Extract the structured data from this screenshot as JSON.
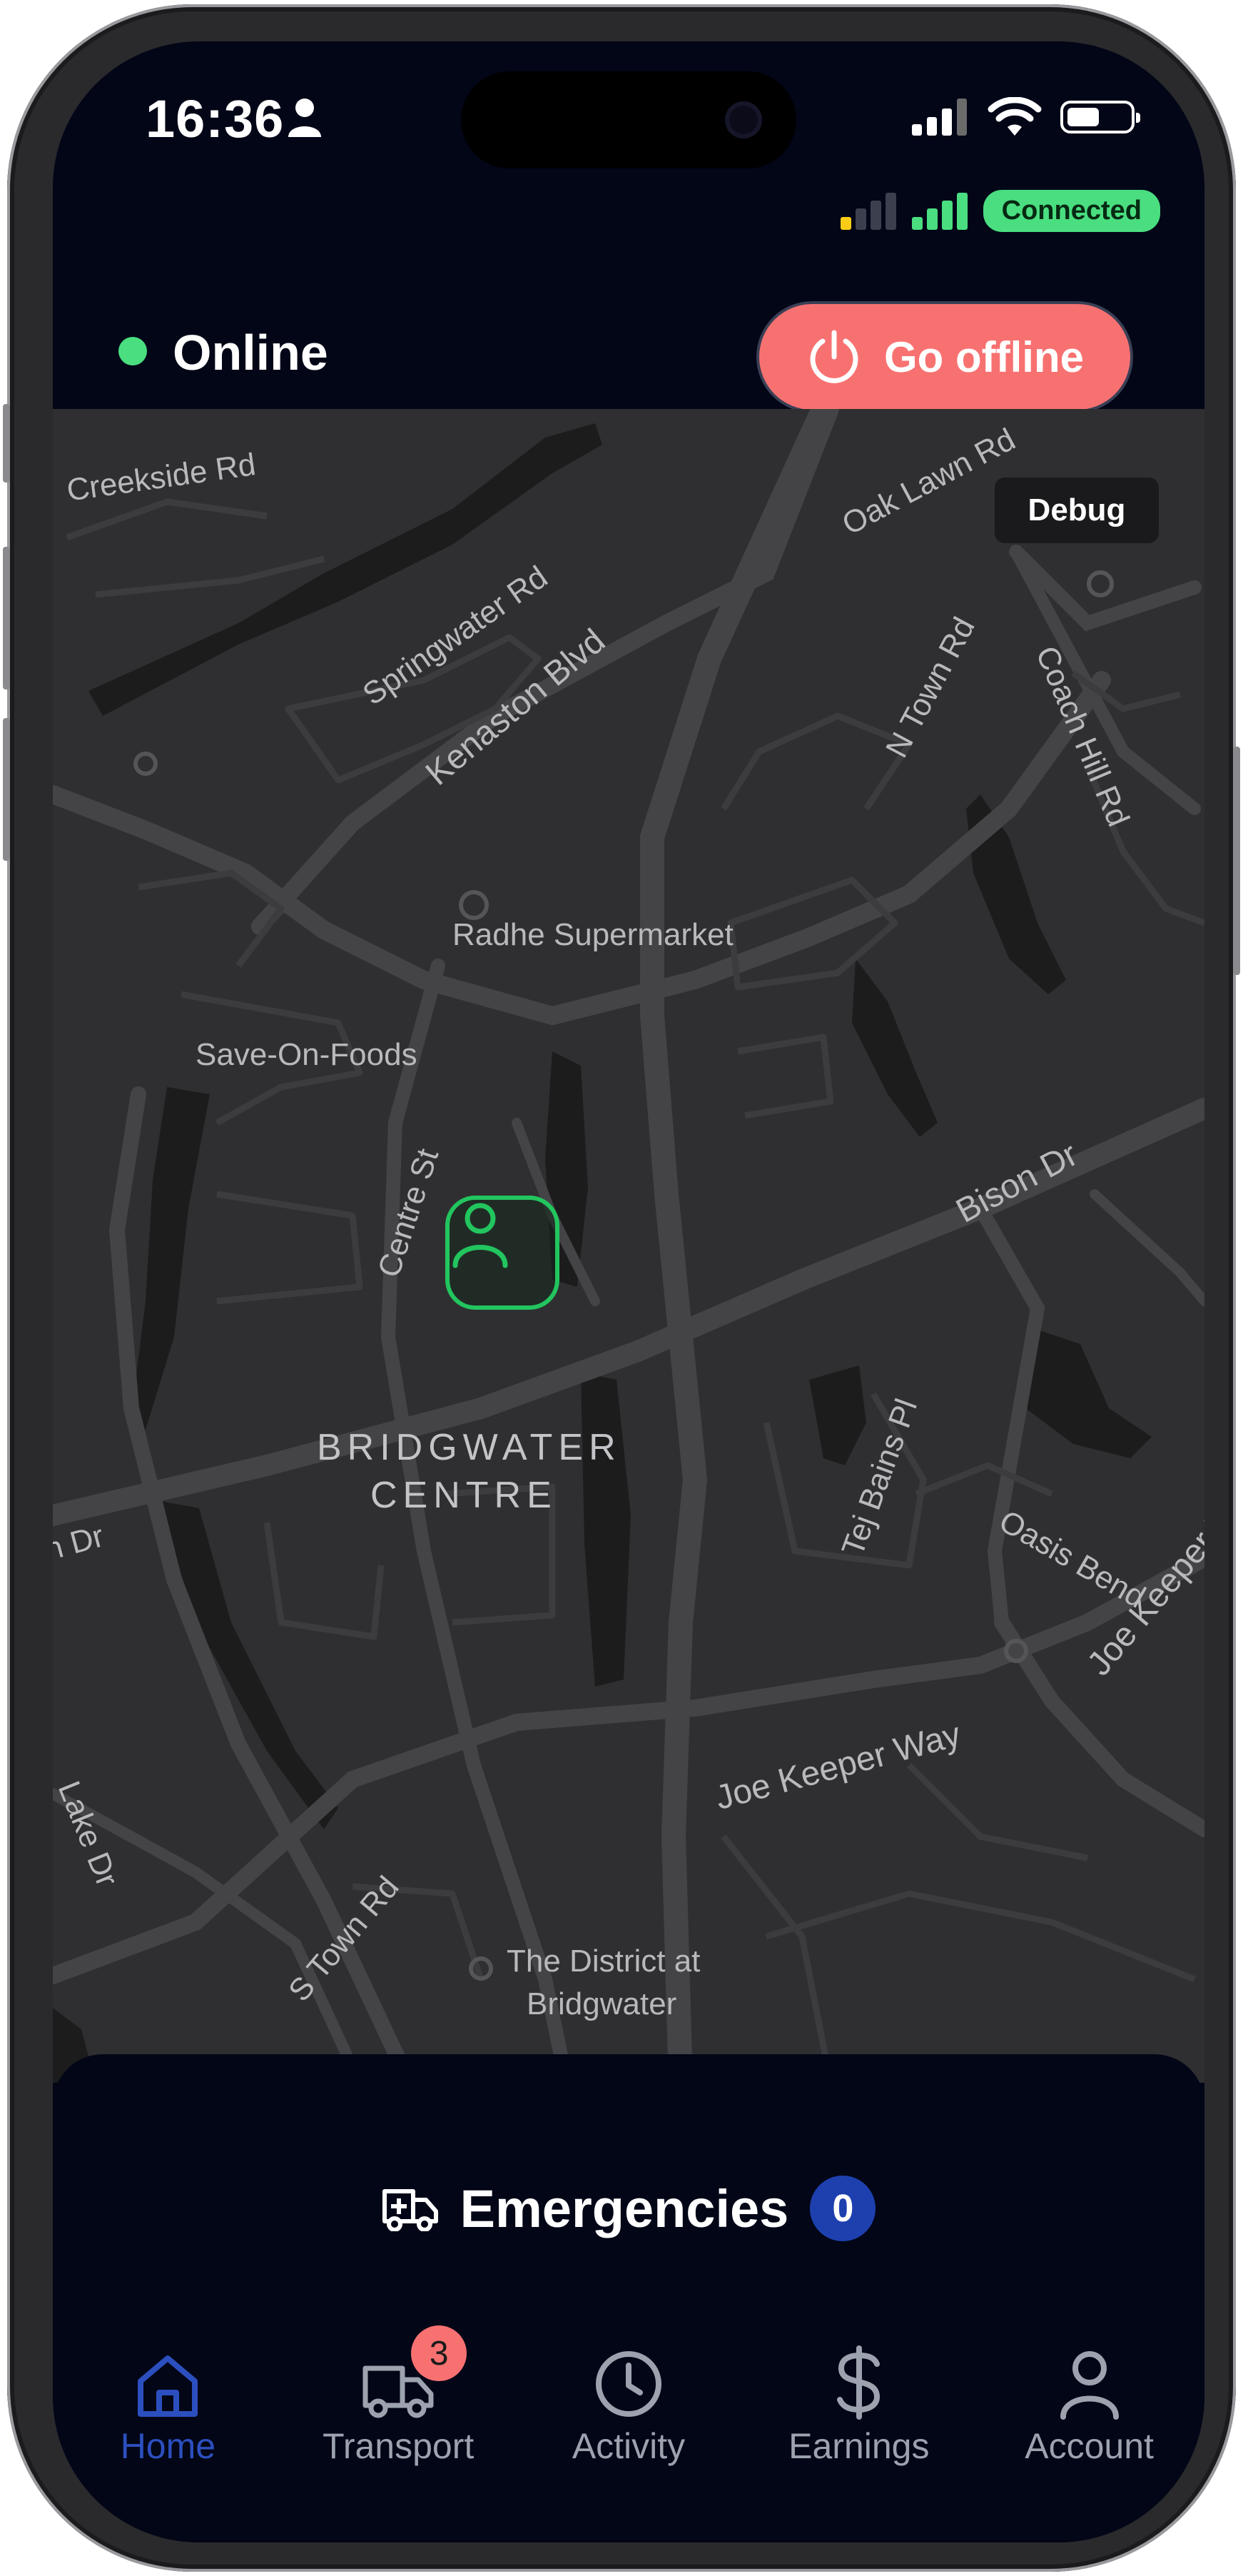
{
  "status_bar": {
    "time": "16:36"
  },
  "connection": {
    "status_label": "Connected"
  },
  "header": {
    "status_label": "Online",
    "go_offline_label": "Go offline"
  },
  "map": {
    "debug_label": "Debug",
    "street_labels": {
      "creekside": "Creekside Rd",
      "springwater": "Springwater Rd",
      "kenaston": "Kenaston Blvd",
      "oak_lawn": "Oak Lawn Rd",
      "n_town": "N Town Rd",
      "coach_hill": "Coach Hill Rd",
      "centre_st": "Centre St",
      "bison": "Bison Dr",
      "tej_bains": "Tej Bains Pl",
      "oasis": "Oasis Bend",
      "joe_keeper_1": "Joe Keeper Way",
      "joe_keeper_2": "Joe Keeper Way",
      "lake_dr": "Lake Dr",
      "s_town": "S Town Rd",
      "dr_left": "n Dr"
    },
    "place_labels": {
      "radhe": "Radhe Supermarket",
      "save_on": "Save-On-Foods",
      "bridgwater_line1": "BRIDGWATER",
      "bridgwater_line2": "CENTRE",
      "district_line1": "The District at",
      "district_line2": "Bridgwater"
    }
  },
  "emergencies": {
    "label": "Emergencies",
    "count": "0"
  },
  "tabs": [
    {
      "label": "Home",
      "icon": "home-icon",
      "active": true
    },
    {
      "label": "Transport",
      "icon": "ambulance-icon",
      "badge": "3"
    },
    {
      "label": "Activity",
      "icon": "clock-icon"
    },
    {
      "label": "Earnings",
      "icon": "dollar-icon"
    },
    {
      "label": "Account",
      "icon": "user-icon"
    }
  ],
  "colors": {
    "background": "#020617",
    "online_green": "#4ade80",
    "offline_button": "#f87171",
    "active_tab": "#2c4fbf",
    "badge_blue": "#1e40af",
    "map_bg": "#2f2f31"
  }
}
